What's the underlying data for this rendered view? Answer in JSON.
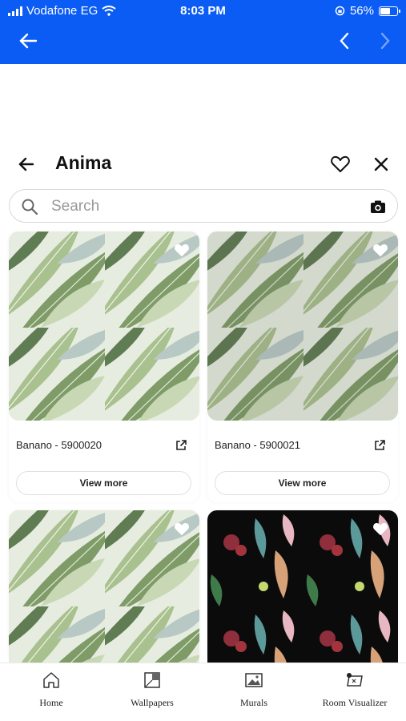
{
  "status_bar": {
    "carrier": "Vodafone EG",
    "time": "8:03 PM",
    "battery": "56%"
  },
  "header": {
    "title": "Anima"
  },
  "search": {
    "placeholder": "Search"
  },
  "products": [
    {
      "name": "Banano - 5900020",
      "button": "View more"
    },
    {
      "name": "Banano - 5900021",
      "button": "View more"
    },
    {
      "name": "",
      "button": ""
    },
    {
      "name": "",
      "button": ""
    }
  ],
  "tabs": [
    {
      "label": "Home",
      "icon": "home-icon"
    },
    {
      "label": "Wallpapers",
      "icon": "wallpapers-icon"
    },
    {
      "label": "Murals",
      "icon": "murals-icon"
    },
    {
      "label": "Room Visualizer",
      "icon": "room-visualizer-icon"
    }
  ],
  "colors": {
    "browser_bar": "#0a5cf5",
    "leaf_bg": "#e8eee2",
    "mural_bg": "#0b0b0b"
  }
}
